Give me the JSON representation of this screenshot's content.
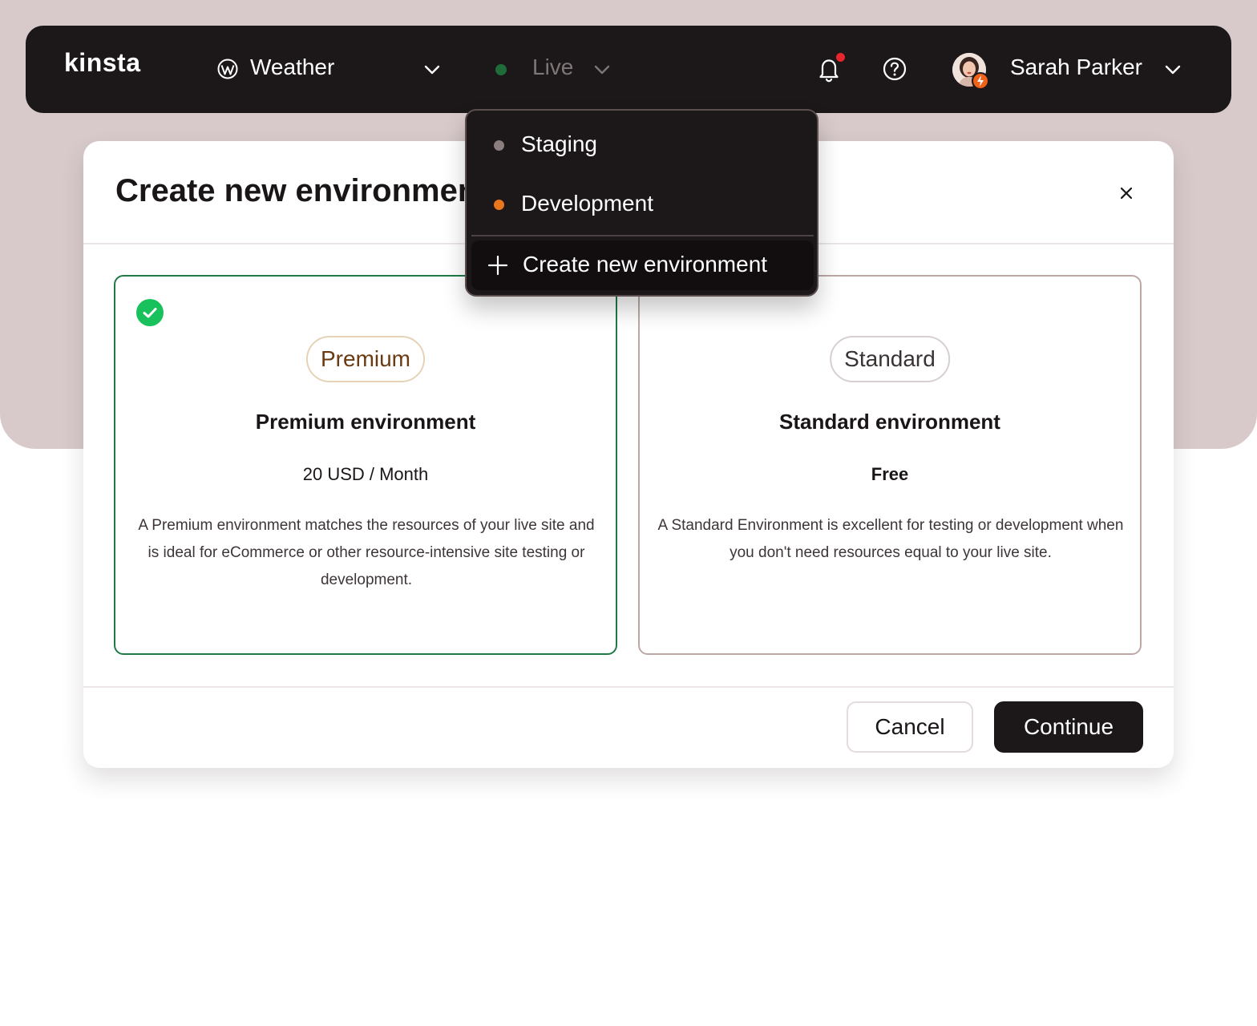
{
  "topbar": {
    "logo": "kinsta",
    "site_name": "Weather",
    "environment": "Live",
    "user_name": "Sarah Parker"
  },
  "modal": {
    "title": "Create new environment",
    "cards": [
      {
        "badge": "Premium",
        "title": "Premium environment",
        "price": "20 USD / Month",
        "description": "A Premium environment matches the resources of your live site and is ideal for eCommerce or other resource-intensive site testing or development.",
        "selected": true
      },
      {
        "badge": "Standard",
        "title": "Standard environment",
        "price": "Free",
        "description": "A Standard Environment is excellent for testing or development when you don't need resources equal to your live site.",
        "selected": false
      }
    ],
    "cancel_label": "Cancel",
    "continue_label": "Continue"
  },
  "dropdown": {
    "items": [
      {
        "label": "Staging",
        "dot_color": "#8a7e7f"
      },
      {
        "label": "Development",
        "dot_color": "#e8761c"
      }
    ],
    "create_label": "Create new environment"
  },
  "colors": {
    "topbar_bg": "#1c1718",
    "backdrop": "#d8cacb",
    "selected_border": "#1e7a47",
    "check_green": "#18c15c",
    "live_dot": "#1f6b3a",
    "notification_dot": "#e6262c"
  },
  "icons": [
    "wordpress-icon",
    "chevron-down-icon",
    "bell-icon",
    "help-icon",
    "avatar",
    "close-icon",
    "check-icon",
    "plus-icon"
  ]
}
